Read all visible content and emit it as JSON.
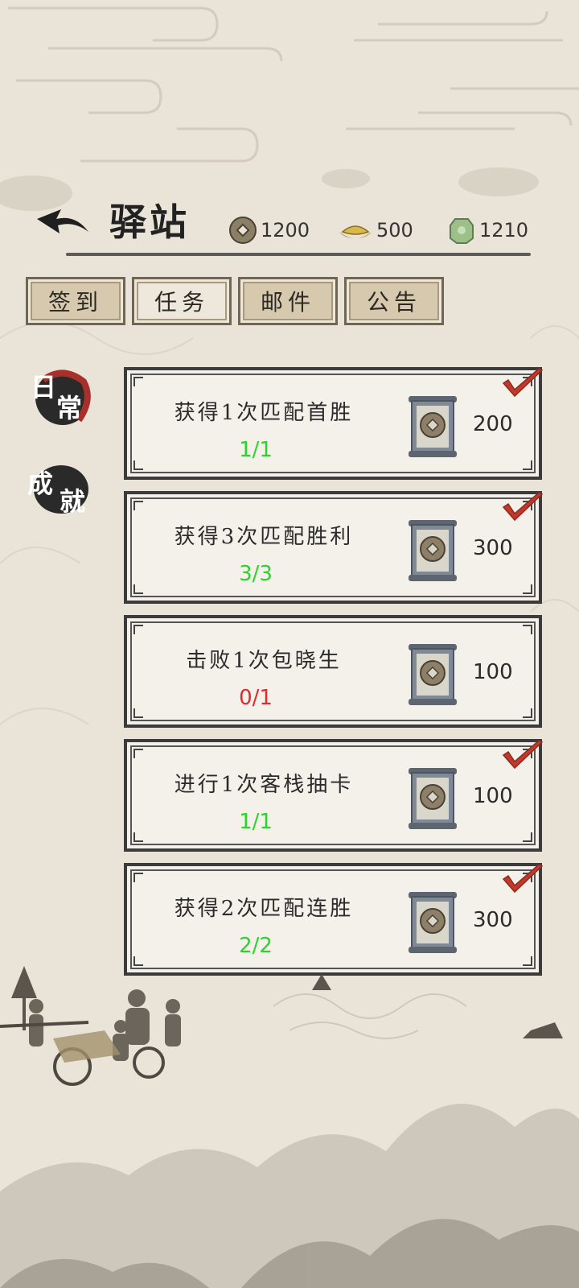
{
  "header": {
    "title": "驿站",
    "currencies": [
      {
        "icon": "copper-coin-icon",
        "value": "1200"
      },
      {
        "icon": "gold-ingot-icon",
        "value": "500"
      },
      {
        "icon": "jade-icon",
        "value": "1210"
      }
    ]
  },
  "tabs": [
    {
      "label": "签到",
      "active": false
    },
    {
      "label": "任务",
      "active": true
    },
    {
      "label": "邮件",
      "active": false
    },
    {
      "label": "公告",
      "active": false
    }
  ],
  "side_tabs": [
    {
      "chars": [
        "日",
        "常"
      ],
      "active": true
    },
    {
      "chars": [
        "成",
        "就"
      ],
      "active": false
    }
  ],
  "tasks": [
    {
      "name": "获得1次匹配首胜",
      "progress": "1/1",
      "complete": true,
      "reward_icon": "coin-scroll-icon",
      "reward": "200"
    },
    {
      "name": "获得3次匹配胜利",
      "progress": "3/3",
      "complete": true,
      "reward_icon": "coin-scroll-icon",
      "reward": "300"
    },
    {
      "name": "击败1次包晓生",
      "progress": "0/1",
      "complete": false,
      "reward_icon": "coin-scroll-icon",
      "reward": "100"
    },
    {
      "name": "进行1次客栈抽卡",
      "progress": "1/1",
      "complete": true,
      "reward_icon": "coin-scroll-icon",
      "reward": "100"
    },
    {
      "name": "获得2次匹配连胜",
      "progress": "2/2",
      "complete": true,
      "reward_icon": "coin-scroll-icon",
      "reward": "300"
    }
  ],
  "colors": {
    "progress_done": "#2fd12f",
    "progress_todo": "#e02b2b",
    "check_mark": "#c0392b"
  }
}
